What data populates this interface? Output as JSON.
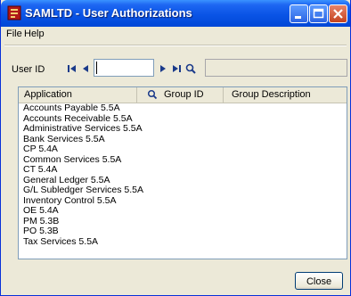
{
  "window": {
    "title": "SAMLTD - User Authorizations"
  },
  "menu": {
    "file": "File",
    "help": "Help"
  },
  "form": {
    "user_id_label": "User ID",
    "user_id_value": ""
  },
  "table": {
    "columns": [
      "Application",
      "Group ID",
      "Group Description"
    ],
    "rows": [
      "Accounts Payable 5.5A",
      "Accounts Receivable 5.5A",
      "Administrative Services 5.5A",
      "Bank Services 5.5A",
      "CP 5.4A",
      "Common Services 5.5A",
      "CT 5.4A",
      "General Ledger 5.5A",
      "G/L Subledger Services 5.5A",
      "Inventory Control 5.5A",
      "OE 5.4A",
      "PM 5.3B",
      "PO 5.3B",
      "Tax Services 5.5A"
    ]
  },
  "buttons": {
    "close": "Close"
  }
}
